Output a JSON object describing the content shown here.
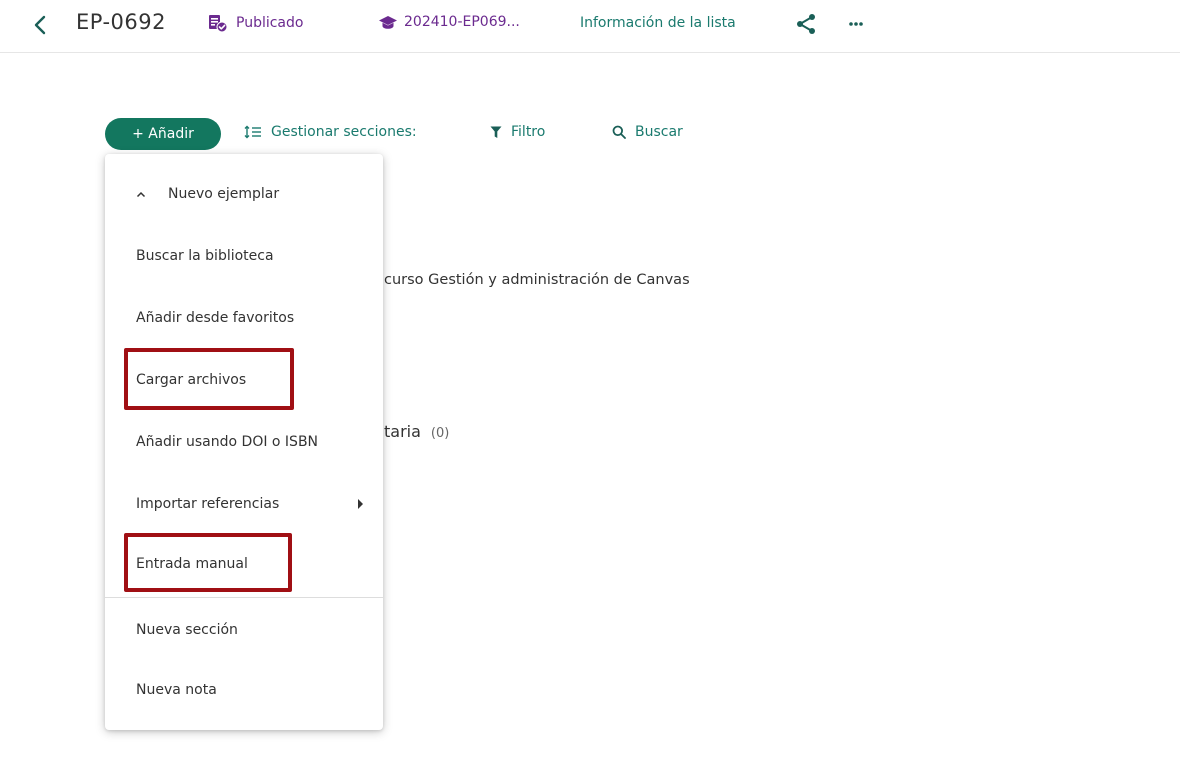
{
  "header": {
    "title": "EP-0692",
    "status_label": "Publicado",
    "course_label": "202410-EP069...",
    "list_info_label": "Información de la lista",
    "icons": {
      "back": "chevron-left-icon",
      "status": "published-list-icon",
      "course": "graduation-cap-icon",
      "share": "share-icon",
      "more": "more-horizontal-icon"
    }
  },
  "toolbar": {
    "add_label": "+ Añadir",
    "manage_sections_label": "Gestionar secciones:",
    "filter_label": "Filtro",
    "search_label": "Buscar"
  },
  "background": {
    "course_text": "curso Gestión y administración de Canvas",
    "section_text": "taria",
    "section_count": "(0)"
  },
  "menu": {
    "header_label": "Nuevo ejemplar",
    "items": [
      "Buscar la biblioteca",
      "Añadir desde favoritos",
      "Cargar archivos",
      "Añadir usando DOI o ISBN",
      "Importar referencias",
      "Entrada manual",
      "Nueva sección",
      "Nueva nota"
    ]
  },
  "colors": {
    "accent_green": "#13775f",
    "link_teal": "#1a7a6e",
    "purple": "#6b2a8f",
    "highlight_red": "#a00f14"
  }
}
